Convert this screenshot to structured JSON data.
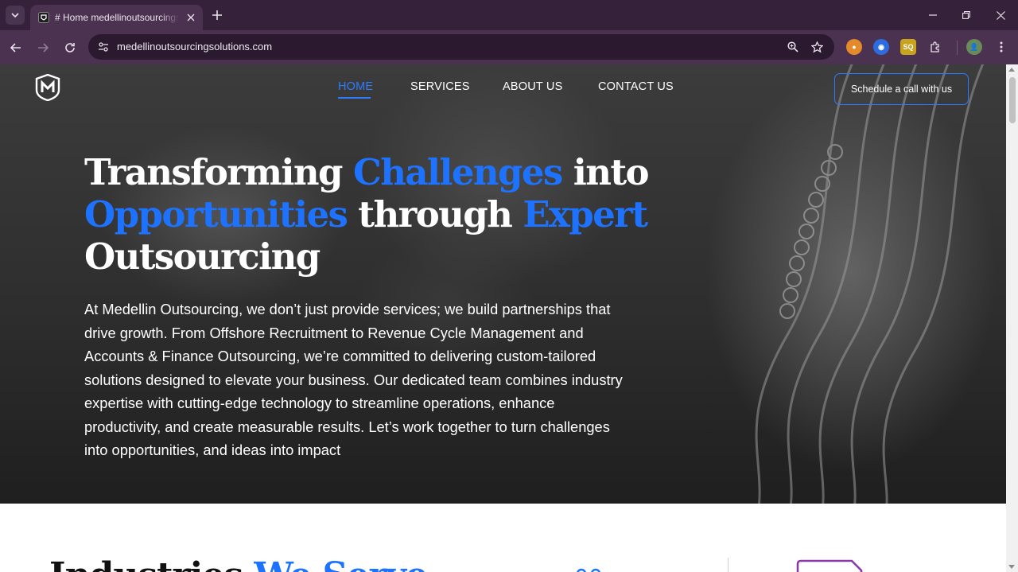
{
  "browser": {
    "tab_title": "# Home medellinoutsourcingsolutions.com",
    "url": "medellinoutsourcingsolutions.com"
  },
  "site": {
    "nav": [
      {
        "label": "HOME",
        "active": true
      },
      {
        "label": "SERVICES",
        "active": false
      },
      {
        "label": "ABOUT US",
        "active": false
      },
      {
        "label": "CONTACT US",
        "active": false
      }
    ],
    "cta_label": "Schedule a call with us",
    "headline": {
      "w1": "Transforming",
      "w2": "Challenges",
      "w3": "into",
      "w4": "Opportunities",
      "w5": "through",
      "w6": "Expert",
      "w7": "Outsourcing"
    },
    "intro": "At Medellin Outsourcing, we don’t just provide services; we build partnerships that drive growth. From Offshore Recruitment to Revenue Cycle Management and Accounts & Finance Outsourcing, we’re committed to delivering custom-tailored solutions designed to elevate your business. Our dedicated team combines industry expertise with cutting-edge technology to streamline operations, enhance productivity, and create measurable results. Let’s work together to turn challenges into opportunities, and ideas into impact",
    "industries": {
      "prefix": "Industries",
      "highlight": "We Serve"
    }
  },
  "colors": {
    "accent": "#1d73ff",
    "browser_frame": "#35213a",
    "toolbar": "#4b3251"
  }
}
